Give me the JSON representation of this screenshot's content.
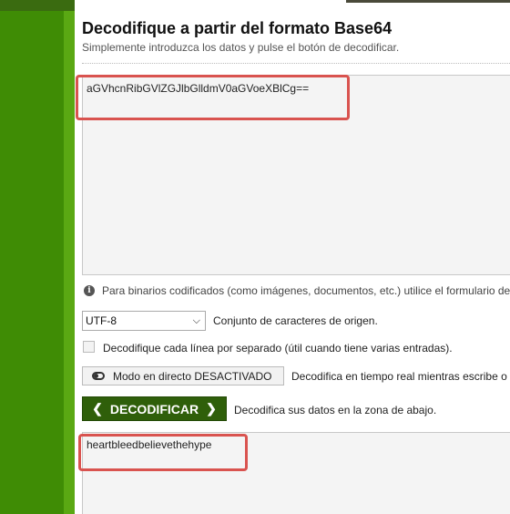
{
  "header": {
    "title": "Decodifique a partir del formato Base64",
    "subtitle": "Simplemente introduzca los datos y pulse el botón de decodificar."
  },
  "input": {
    "value": "aGVhcnRibGVlZGJlbGlldmV0aGVoeXBlCg=="
  },
  "info": {
    "icon": "info-icon",
    "text": "Para binarios codificados (como imágenes, documentos, etc.) utilice el formulario de"
  },
  "charset": {
    "selected": "UTF-8",
    "label": "Conjunto de caracteres de origen."
  },
  "per_line": {
    "label": "Decodifique cada línea por separado (útil cuando tiene varias entradas)."
  },
  "live_mode": {
    "button_label": "Modo en directo DESACTIVADO",
    "description": "Decodifica en tiempo real mientras escribe o"
  },
  "decode": {
    "button_label": "DECODIFICAR",
    "description": "Decodifica sus datos en la zona de abajo."
  },
  "output": {
    "value": "heartbleedbelievethehype"
  },
  "colors": {
    "accent_green": "#2f5f0a",
    "highlight_red": "#d9534f"
  }
}
